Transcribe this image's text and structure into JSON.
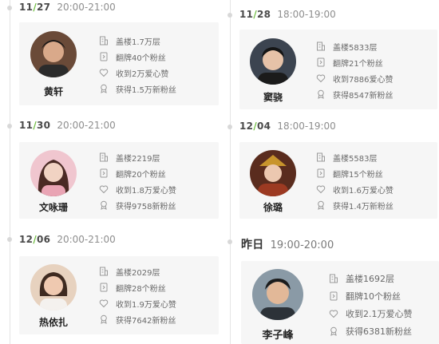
{
  "entries": [
    {
      "date_month": "11",
      "date_day": "27",
      "time": "20:00-21:00",
      "name": "黄轩",
      "stats": [
        "盖楼1.7万层",
        "翻牌40个粉丝",
        "收到2万爱心赞",
        "获得1.5万新粉丝"
      ]
    },
    {
      "date_month": "11",
      "date_day": "28",
      "time": "18:00-19:00",
      "name": "窦骁",
      "stats": [
        "盖楼5833层",
        "翻牌21个粉丝",
        "收到7886爱心赞",
        "获得8547新粉丝"
      ]
    },
    {
      "date_month": "11",
      "date_day": "30",
      "time": "20:00-21:00",
      "name": "文咏珊",
      "stats": [
        "盖楼2219层",
        "翻牌20个粉丝",
        "收到1.8万爱心赞",
        "获得9758新粉丝"
      ]
    },
    {
      "date_month": "12",
      "date_day": "04",
      "time": "18:00-19:00",
      "name": "徐璐",
      "stats": [
        "盖楼5583层",
        "翻牌15个粉丝",
        "收到1.6万爱心赞",
        "获得1.4万新粉丝"
      ]
    },
    {
      "date_month": "12",
      "date_day": "06",
      "time": "20:00-21:00",
      "name": "热依扎",
      "stats": [
        "盖楼2029层",
        "翻牌28个粉丝",
        "收到1.9万爱心赞",
        "获得7642新粉丝"
      ]
    },
    {
      "date_label": "昨日",
      "time": "19:00-20:00",
      "name": "李子峰",
      "stats": [
        "盖楼1692层",
        "翻牌10个粉丝",
        "收到2.1万爱心赞",
        "获得6381新粉丝"
      ]
    }
  ],
  "date_separator": "/",
  "stat_icons": [
    "building-icon",
    "card-flip-icon",
    "heart-icon",
    "badge-icon"
  ],
  "colors": {
    "accent": "#74c048",
    "card_bg": "#f6f6f6",
    "timeline": "#e4e4e4"
  }
}
